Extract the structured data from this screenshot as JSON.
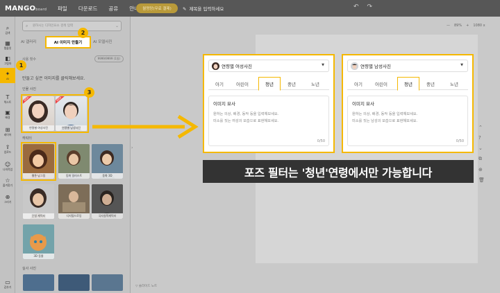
{
  "app": {
    "logo": "MANGO",
    "logo_sub": "board",
    "menu": [
      "파일",
      "다운로드",
      "공유",
      "안내"
    ],
    "upgrade_label": "월멍망(무료 결제)",
    "title_placeholder": "제목을 입력하세요",
    "zoom": [
      "—",
      "89%",
      "+",
      "1080 x"
    ]
  },
  "rail": [
    {
      "icon": "⌕",
      "label": "검색"
    },
    {
      "icon": "▦",
      "label": "템플릿"
    },
    {
      "icon": "◧",
      "label": "그림자"
    },
    {
      "icon": "✦",
      "label": "AI"
    },
    {
      "icon": "T",
      "label": "텍스트"
    },
    {
      "icon": "▣",
      "label": "배경"
    },
    {
      "icon": "⊞",
      "label": "레이어"
    },
    {
      "icon": "⇪",
      "label": "업로드"
    },
    {
      "icon": "☺",
      "label": "나의작업"
    },
    {
      "icon": "☆",
      "label": "즐겨찾기"
    },
    {
      "icon": "⊕",
      "label": "그리기"
    },
    {
      "icon": "▭",
      "label": "감추기"
    }
  ],
  "panel": {
    "search_placeholder": "원하시는 디자인요소 검색 입력",
    "tabs": [
      "AI 갤러리",
      "AI 이미지 만들기",
      "AI 모델사진"
    ],
    "credit_label": "사용 횟수",
    "credit_value": "9999/9999 (1일)",
    "help": "만들고 싶은 이미지를 클릭해보세요.",
    "sec_person": "인물 사진",
    "sec_character": "캐릭터",
    "sec_real": "실사 사진",
    "person_items": [
      {
        "label": "연령별 여성사진",
        "badge": "NEW"
      },
      {
        "label": "연령별 남성사진",
        "badge": "NEW"
      }
    ],
    "character_items": [
      {
        "label": "웹툰·남그림"
      },
      {
        "label": "동화 일러스트"
      },
      {
        "label": "동화 3D"
      },
      {
        "label": "단일 캐릭터"
      },
      {
        "label": "디지털드로잉"
      },
      {
        "label": "국사실적캐릭터"
      },
      {
        "label": "3D 동물"
      }
    ]
  },
  "cards": [
    {
      "select": "연령별 여성사진",
      "ages": [
        "아기",
        "어린이",
        "청년",
        "중년",
        "노년"
      ],
      "active_age": "청년",
      "desc_title": "이미지 묘사",
      "desc_lines": [
        "원하는 의상, 배경, 동작 등을 입력해보세요.",
        "미소를 짓는 여성의 모습으로 표현해보세요."
      ],
      "count": "0/50"
    },
    {
      "select": "연령별 남성사진",
      "ages": [
        "아기",
        "어린이",
        "청년",
        "중년",
        "노년"
      ],
      "active_age": "청년",
      "desc_title": "이미지 묘사",
      "desc_lines": [
        "원하는 의상, 배경, 동작 등을 입력해보세요.",
        "미소를 짓는 남성의 모습으로 표현해보세요."
      ],
      "count": "0/50"
    }
  ],
  "overlay": {
    "steps": [
      "1",
      "2",
      "3"
    ],
    "banner": "포즈 필터는 '청년'연령에서만 가능합니다"
  },
  "slide_note": "슬라이드 노트",
  "colors": {
    "accent": "#f5b800",
    "topbar": "#575757",
    "banner": "#333333"
  }
}
